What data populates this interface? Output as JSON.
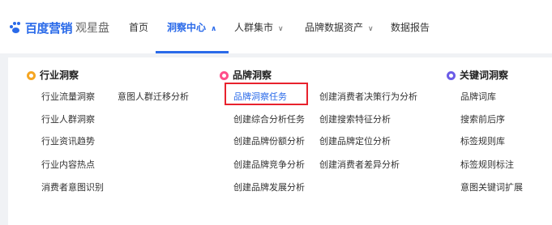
{
  "brand": {
    "name": "百度营销",
    "product": "观星盘"
  },
  "nav": {
    "home": "首页",
    "insight_center": "洞察中心",
    "audience_market": "人群集市",
    "brand_assets": "品牌数据资产",
    "reports": "数据报告"
  },
  "columns": {
    "industry": {
      "title": "行业洞察",
      "items": [
        "行业流量洞察",
        "意图人群迁移分析",
        "行业人群洞察",
        "行业资讯趋势",
        "行业内容热点",
        "消费者意图识别"
      ]
    },
    "brand": {
      "title": "品牌洞察",
      "items": [
        "品牌洞察任务",
        "创建消费者决策行为分析",
        "创建综合分析任务",
        "创建搜索特征分析",
        "创建品牌份额分析",
        "创建品牌定位分析",
        "创建品牌竞争分析",
        "创建消费者差异分析",
        "创建品牌发展分析"
      ]
    },
    "keyword": {
      "title": "关键词洞察",
      "items": [
        "品牌词库",
        "搜索前后序",
        "标签规则库",
        "标签规则标注",
        "意图关键词扩展"
      ]
    }
  },
  "colors": {
    "accent": "#2a6ae9",
    "highlight_border": "#e8222d"
  }
}
